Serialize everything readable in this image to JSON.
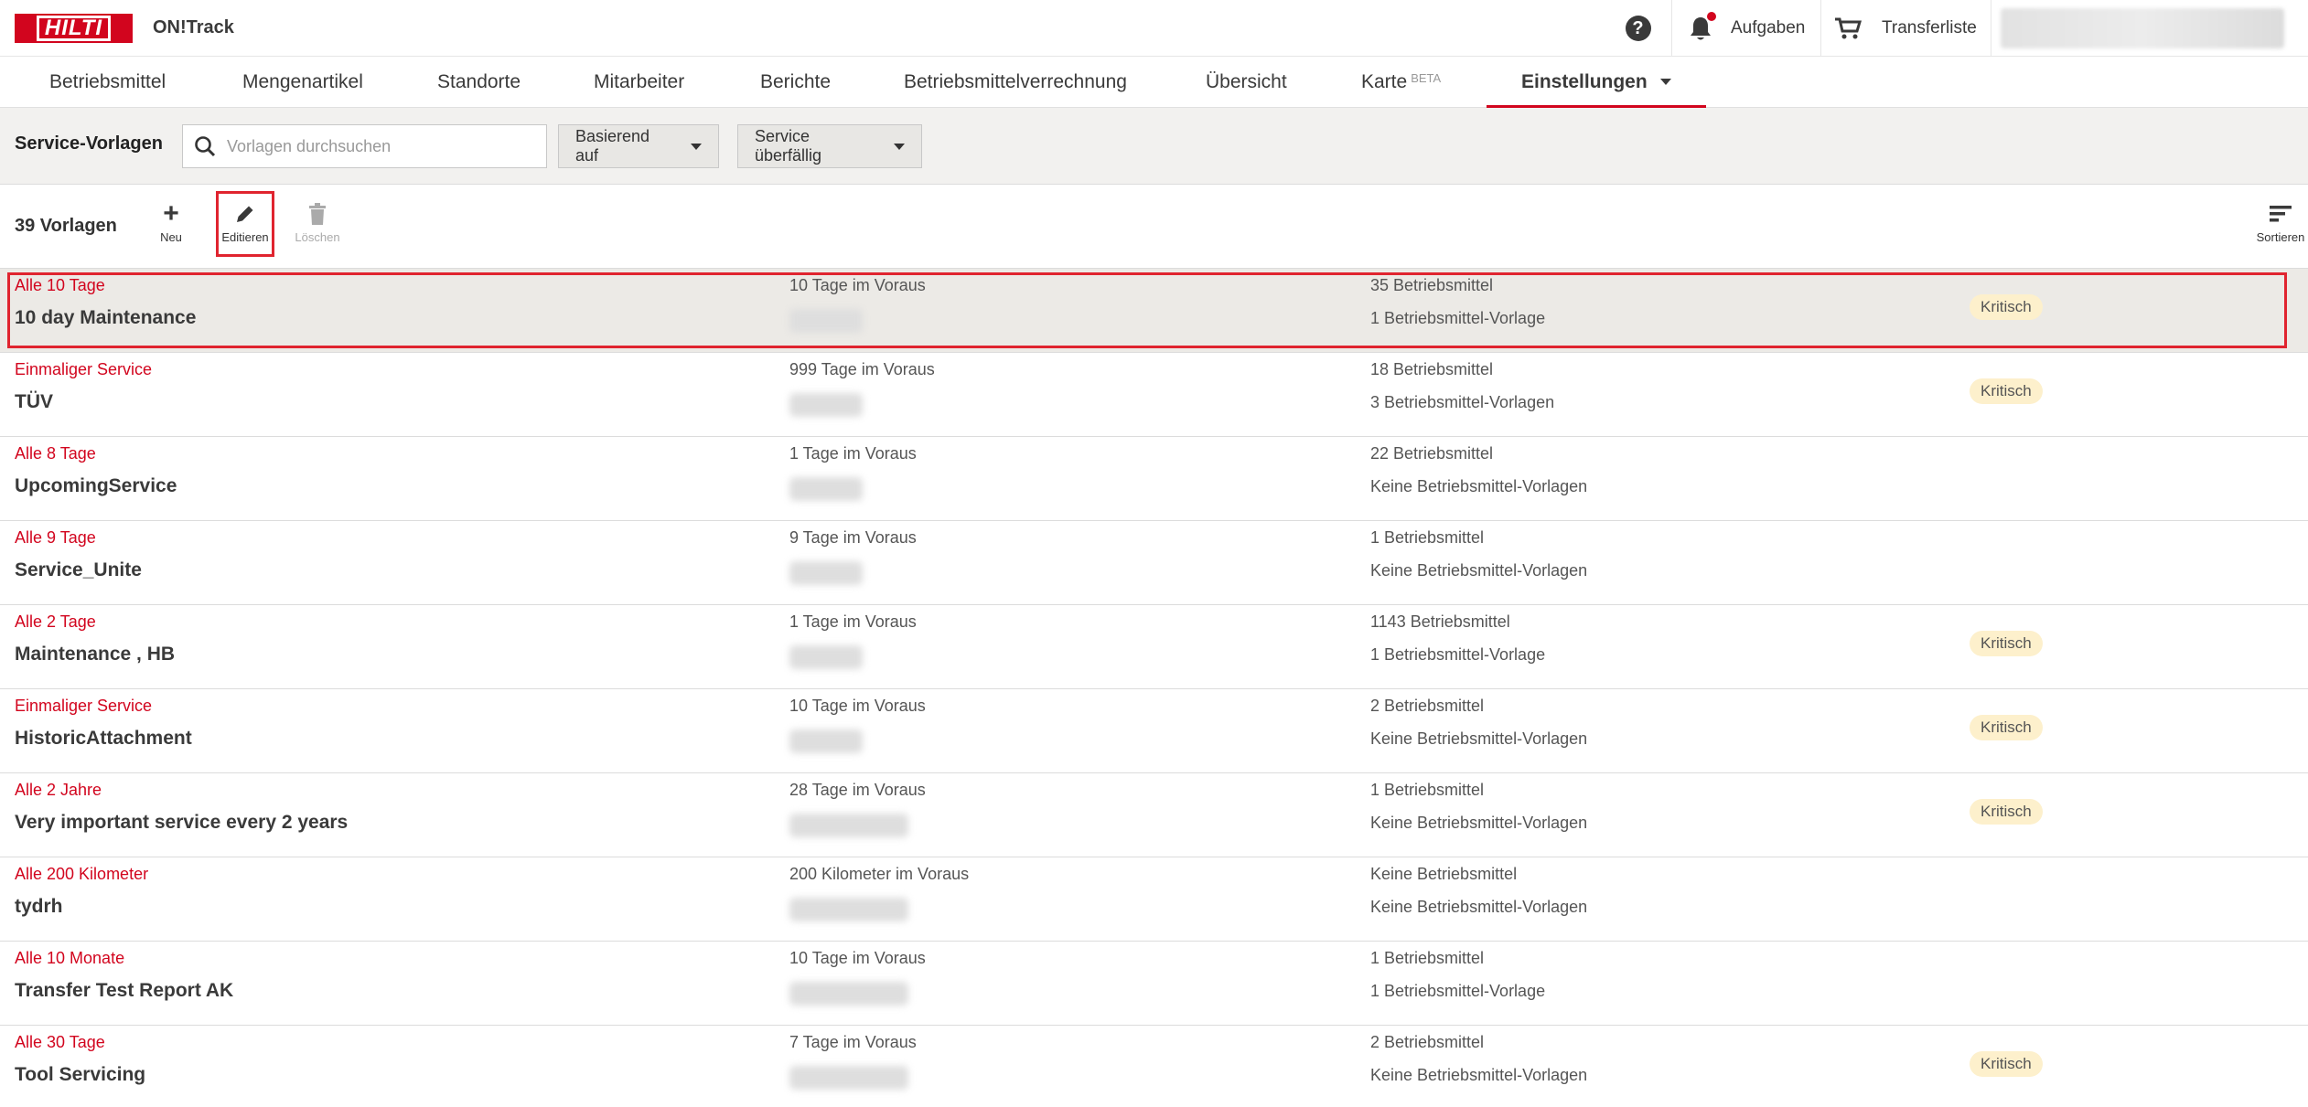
{
  "header": {
    "brand": "HILTI",
    "app_name": "ON!Track",
    "help_symbol": "?",
    "tasks_label": "Aufgaben",
    "transfer_label": "Transferliste",
    "accent_color": "#d2051e"
  },
  "nav": {
    "items": [
      {
        "label": "Betriebsmittel"
      },
      {
        "label": "Mengenartikel"
      },
      {
        "label": "Standorte"
      },
      {
        "label": "Mitarbeiter"
      },
      {
        "label": "Berichte"
      },
      {
        "label": "Betriebsmittelverrechnung"
      },
      {
        "label": "Übersicht"
      },
      {
        "label": "Karte",
        "badge": "BETA"
      },
      {
        "label": "Einstellungen",
        "active": true
      }
    ]
  },
  "filterbar": {
    "title": "Service-Vorlagen",
    "search_placeholder": "Vorlagen durchsuchen",
    "search_value": "",
    "dropdown_based_on": "Basierend auf",
    "dropdown_overdue": "Service überfällig"
  },
  "actionbar": {
    "count_label": "39 Vorlagen",
    "new_label": "Neu",
    "edit_label": "Editieren",
    "delete_label": "Löschen",
    "sort_label": "Sortieren"
  },
  "templates": [
    {
      "interval": "Alle 10 Tage",
      "name": "10 day Maintenance",
      "advance": "10 Tage im Voraus",
      "assets": "35 Betriebsmittel",
      "asset_templates": "1 Betriebsmittel-Vorlage",
      "badge": "Kritisch",
      "selected": true
    },
    {
      "interval": "Einmaliger Service",
      "name": "TÜV",
      "advance": "999 Tage im Voraus",
      "assets": "18 Betriebsmittel",
      "asset_templates": "3 Betriebsmittel-Vorlagen",
      "badge": "Kritisch"
    },
    {
      "interval": "Alle 8 Tage",
      "name": "UpcomingService",
      "advance": "1 Tage im Voraus",
      "assets": "22 Betriebsmittel",
      "asset_templates": "Keine Betriebsmittel-Vorlagen",
      "badge": ""
    },
    {
      "interval": "Alle 9 Tage",
      "name": "Service_Unite",
      "advance": "9 Tage im Voraus",
      "assets": "1 Betriebsmittel",
      "asset_templates": "Keine Betriebsmittel-Vorlagen",
      "badge": ""
    },
    {
      "interval": "Alle 2 Tage",
      "name": "Maintenance , HB",
      "advance": "1 Tage im Voraus",
      "assets": "1143 Betriebsmittel",
      "asset_templates": "1 Betriebsmittel-Vorlage",
      "badge": "Kritisch"
    },
    {
      "interval": "Einmaliger Service",
      "name": "HistoricAttachment",
      "advance": "10 Tage im Voraus",
      "assets": "2 Betriebsmittel",
      "asset_templates": "Keine Betriebsmittel-Vorlagen",
      "badge": "Kritisch"
    },
    {
      "interval": "Alle 2 Jahre",
      "name": "Very important service every 2 years",
      "advance": "28 Tage im Voraus",
      "assets": "1 Betriebsmittel",
      "asset_templates": "Keine Betriebsmittel-Vorlagen",
      "badge": "Kritisch"
    },
    {
      "interval": "Alle 200 Kilometer",
      "name": "tydrh",
      "advance": "200 Kilometer im Voraus",
      "assets": "Keine Betriebsmittel",
      "asset_templates": "Keine Betriebsmittel-Vorlagen",
      "badge": ""
    },
    {
      "interval": "Alle 10 Monate",
      "name": "Transfer Test Report AK",
      "advance": "10 Tage im Voraus",
      "assets": "1 Betriebsmittel",
      "asset_templates": "1 Betriebsmittel-Vorlage",
      "badge": ""
    },
    {
      "interval": "Alle 30 Tage",
      "name": "Tool Servicing",
      "advance": "7 Tage im Voraus",
      "assets": "2 Betriebsmittel",
      "asset_templates": "Keine Betriebsmittel-Vorlagen",
      "badge": "Kritisch"
    }
  ]
}
